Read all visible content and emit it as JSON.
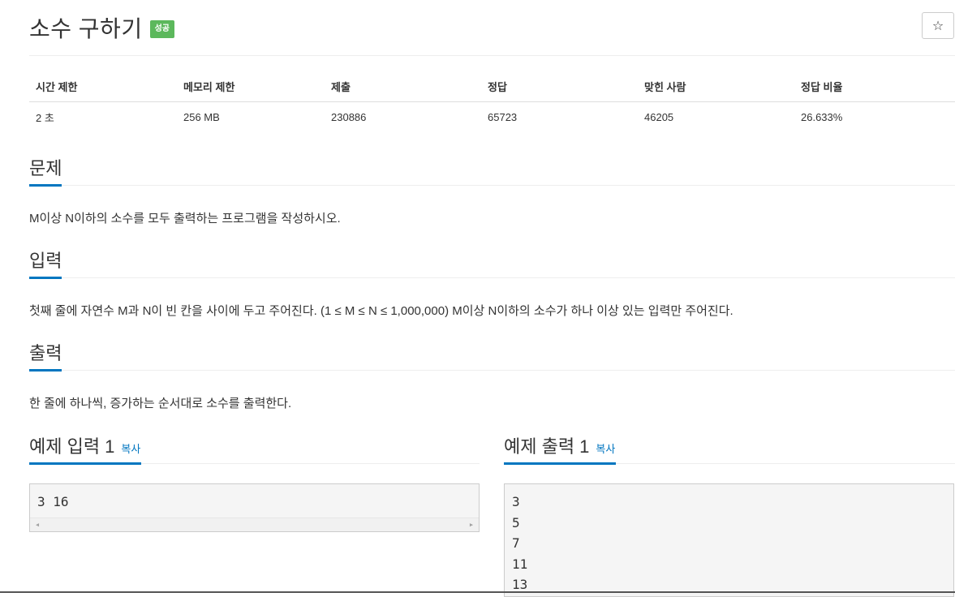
{
  "header": {
    "title": "소수 구하기",
    "badge": "성공",
    "star_icon": "☆"
  },
  "stats": {
    "headers": [
      "시간 제한",
      "메모리 제한",
      "제출",
      "정답",
      "맞힌 사람",
      "정답 비율"
    ],
    "values": [
      "2 초",
      "256 MB",
      "230886",
      "65723",
      "46205",
      "26.633%"
    ]
  },
  "sections": {
    "problem": {
      "title": "문제",
      "body": "M이상 N이하의 소수를 모두 출력하는 프로그램을 작성하시오."
    },
    "input": {
      "title": "입력",
      "body": "첫째 줄에 자연수 M과 N이 빈 칸을 사이에 두고 주어진다. (1 ≤ M ≤ N ≤ 1,000,000) M이상 N이하의 소수가 하나 이상 있는 입력만 주어진다."
    },
    "output": {
      "title": "출력",
      "body": "한 줄에 하나씩, 증가하는 순서대로 소수를 출력한다."
    }
  },
  "samples": {
    "input": {
      "title": "예제 입력 1",
      "copy_label": "복사",
      "lines": [
        "3 16"
      ]
    },
    "output": {
      "title": "예제 출력 1",
      "copy_label": "복사",
      "lines": [
        "3",
        "5",
        "7",
        "11",
        "13"
      ]
    }
  },
  "colors": {
    "accent": "#0076c0",
    "success_badge": "#5cb85c"
  },
  "icons": {
    "star": "star-icon",
    "scroll_left": "chevron-left-icon",
    "scroll_right": "chevron-right-icon"
  }
}
